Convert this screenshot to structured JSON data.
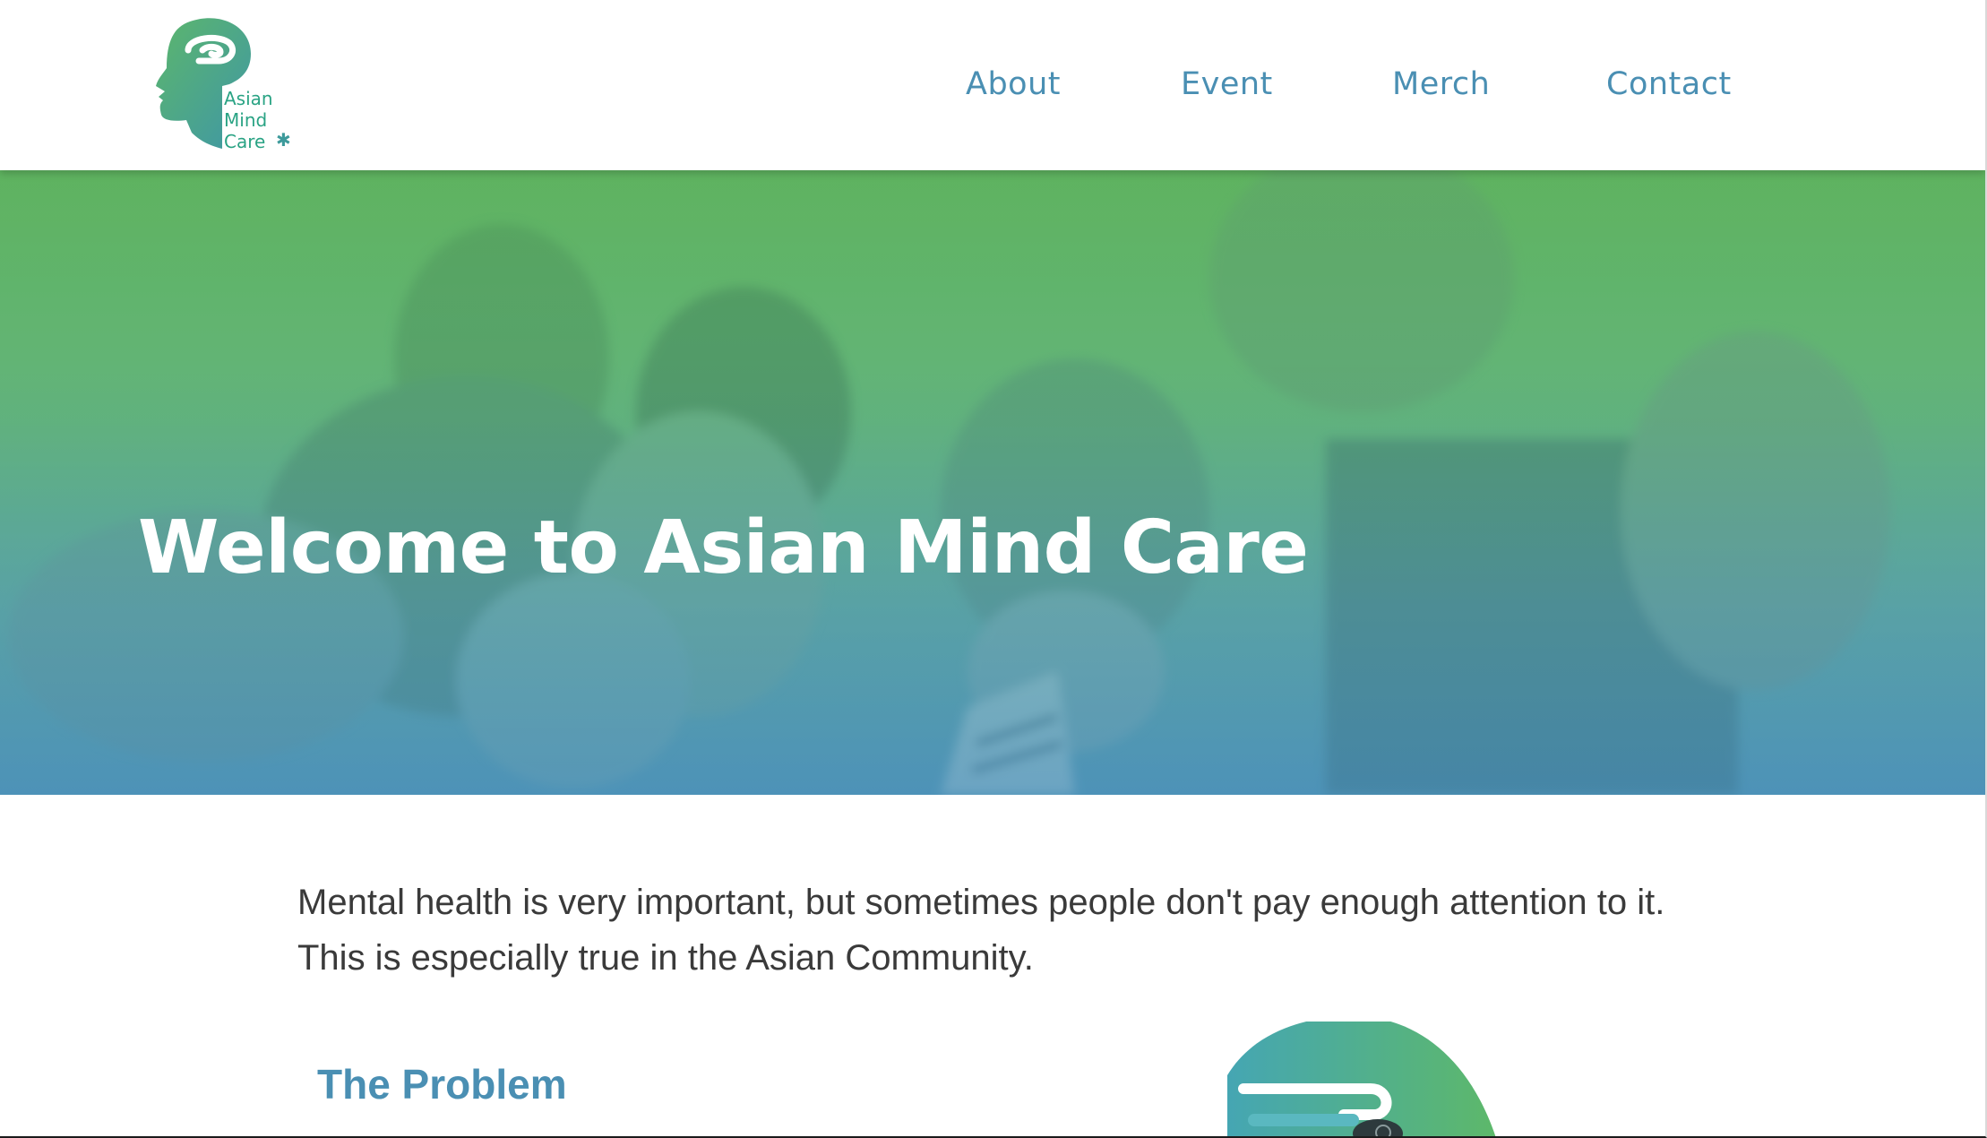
{
  "brand": {
    "logo_lines": [
      "Asian",
      "Mind",
      "Care"
    ],
    "logo_star": "✱"
  },
  "nav": {
    "about": "About",
    "event": "Event",
    "merch": "Merch",
    "contact": "Contact"
  },
  "hero": {
    "title": "Welcome to Asian Mind Care"
  },
  "intro": {
    "text": "Mental health is very important, but sometimes people don't pay enough attention to it. This is especially true in the Asian Community."
  },
  "problem": {
    "heading": "The Problem"
  },
  "colors": {
    "brand_green": "#5db66e",
    "brand_blue": "#4a8fb3",
    "text_dark": "#3a3a3a"
  }
}
